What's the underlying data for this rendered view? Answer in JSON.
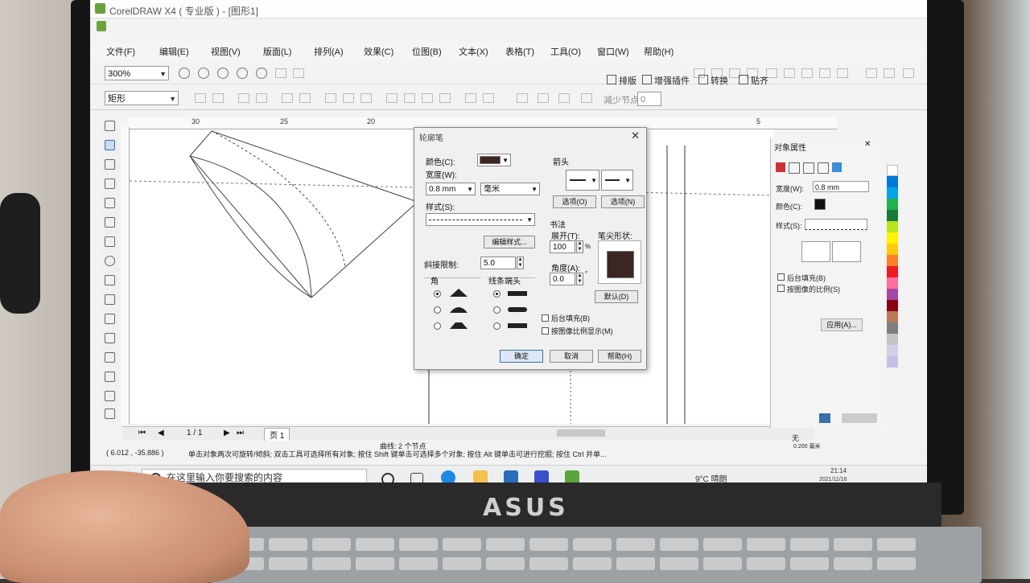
{
  "window": {
    "title": "CorelDRAW X4 ( 专业版 ) - [图形1]"
  },
  "menu": {
    "items": [
      "文件(F)",
      "编辑(E)",
      "视图(V)",
      "版面(L)",
      "排列(A)",
      "效果(C)",
      "位图(B)",
      "文本(X)",
      "表格(T)",
      "工具(O)",
      "窗口(W)",
      "帮助(H)"
    ]
  },
  "toolbar": {
    "zoom_value": "300%",
    "shape_select": "矩形",
    "nodes_label": "减少节点",
    "nodes_value": "0",
    "buttons": [
      "排版",
      "增强插件",
      "转换",
      "贴齐"
    ]
  },
  "ruler": {
    "top_marks": [
      "30",
      "25",
      "20",
      "5"
    ]
  },
  "dialog": {
    "title": "轮廓笔",
    "color_label": "颜色(C):",
    "width_label": "宽度(W):",
    "width_value": "0.8 mm",
    "unit_value": "毫米",
    "style_label": "样式(S):",
    "edit_style": "编辑样式...",
    "miter_label": "斜接限制:",
    "miter_value": "5.0",
    "corners_label": "角",
    "line_caps_label": "线条端头",
    "arrows_label": "箭头",
    "arrow_opt_left": "选项(O)",
    "arrow_opt_right": "选项(N)",
    "calligraphy_label": "书法",
    "stretch_label": "展开(T):",
    "stretch_value": "100",
    "stretch_unit": "%",
    "angle_label": "角度(A):",
    "angle_value": "0.0",
    "angle_unit": "°",
    "nib_label": "笔尖形状:",
    "default_btn": "默认(D)",
    "behind_fill": "后台填充(B)",
    "scale_image": "按图像比例显示(M)",
    "ok": "确定",
    "cancel": "取消",
    "help": "帮助(H)"
  },
  "docker": {
    "title": "对象属性",
    "width_label": "宽度(W):",
    "width_value": "0.8 mm",
    "color_label": "颜色(C):",
    "style_label": "样式(S):",
    "behind_fill": "后台填充(B)",
    "scale_image": "按图像的比例(S)",
    "apply": "应用(A)..."
  },
  "pagebar": {
    "page_count": "1 / 1",
    "page_tab": "页 1"
  },
  "status": {
    "coords": "( 6.012 , -35.886 )",
    "object_info": "曲线: 2 个节点",
    "hint": "单击对象两次可旋转/倾斜; 双击工具可选择所有对象; 按住 Shift 键单击可选择多个对象; 按住 Alt 键单击可进行挖掘; 按住 Ctrl 并单...",
    "fill_label": "无",
    "outline_label": "0.200 毫米"
  },
  "taskbar": {
    "search_placeholder": "在这里输入你要搜索的内容",
    "weather": "9°C 晴朗",
    "time": "21:14",
    "date": "2021/11/16"
  },
  "laptop": {
    "brand": "ASUS"
  },
  "colors": {
    "swatch": "#3b2624",
    "accent": "#3a6fa8"
  }
}
